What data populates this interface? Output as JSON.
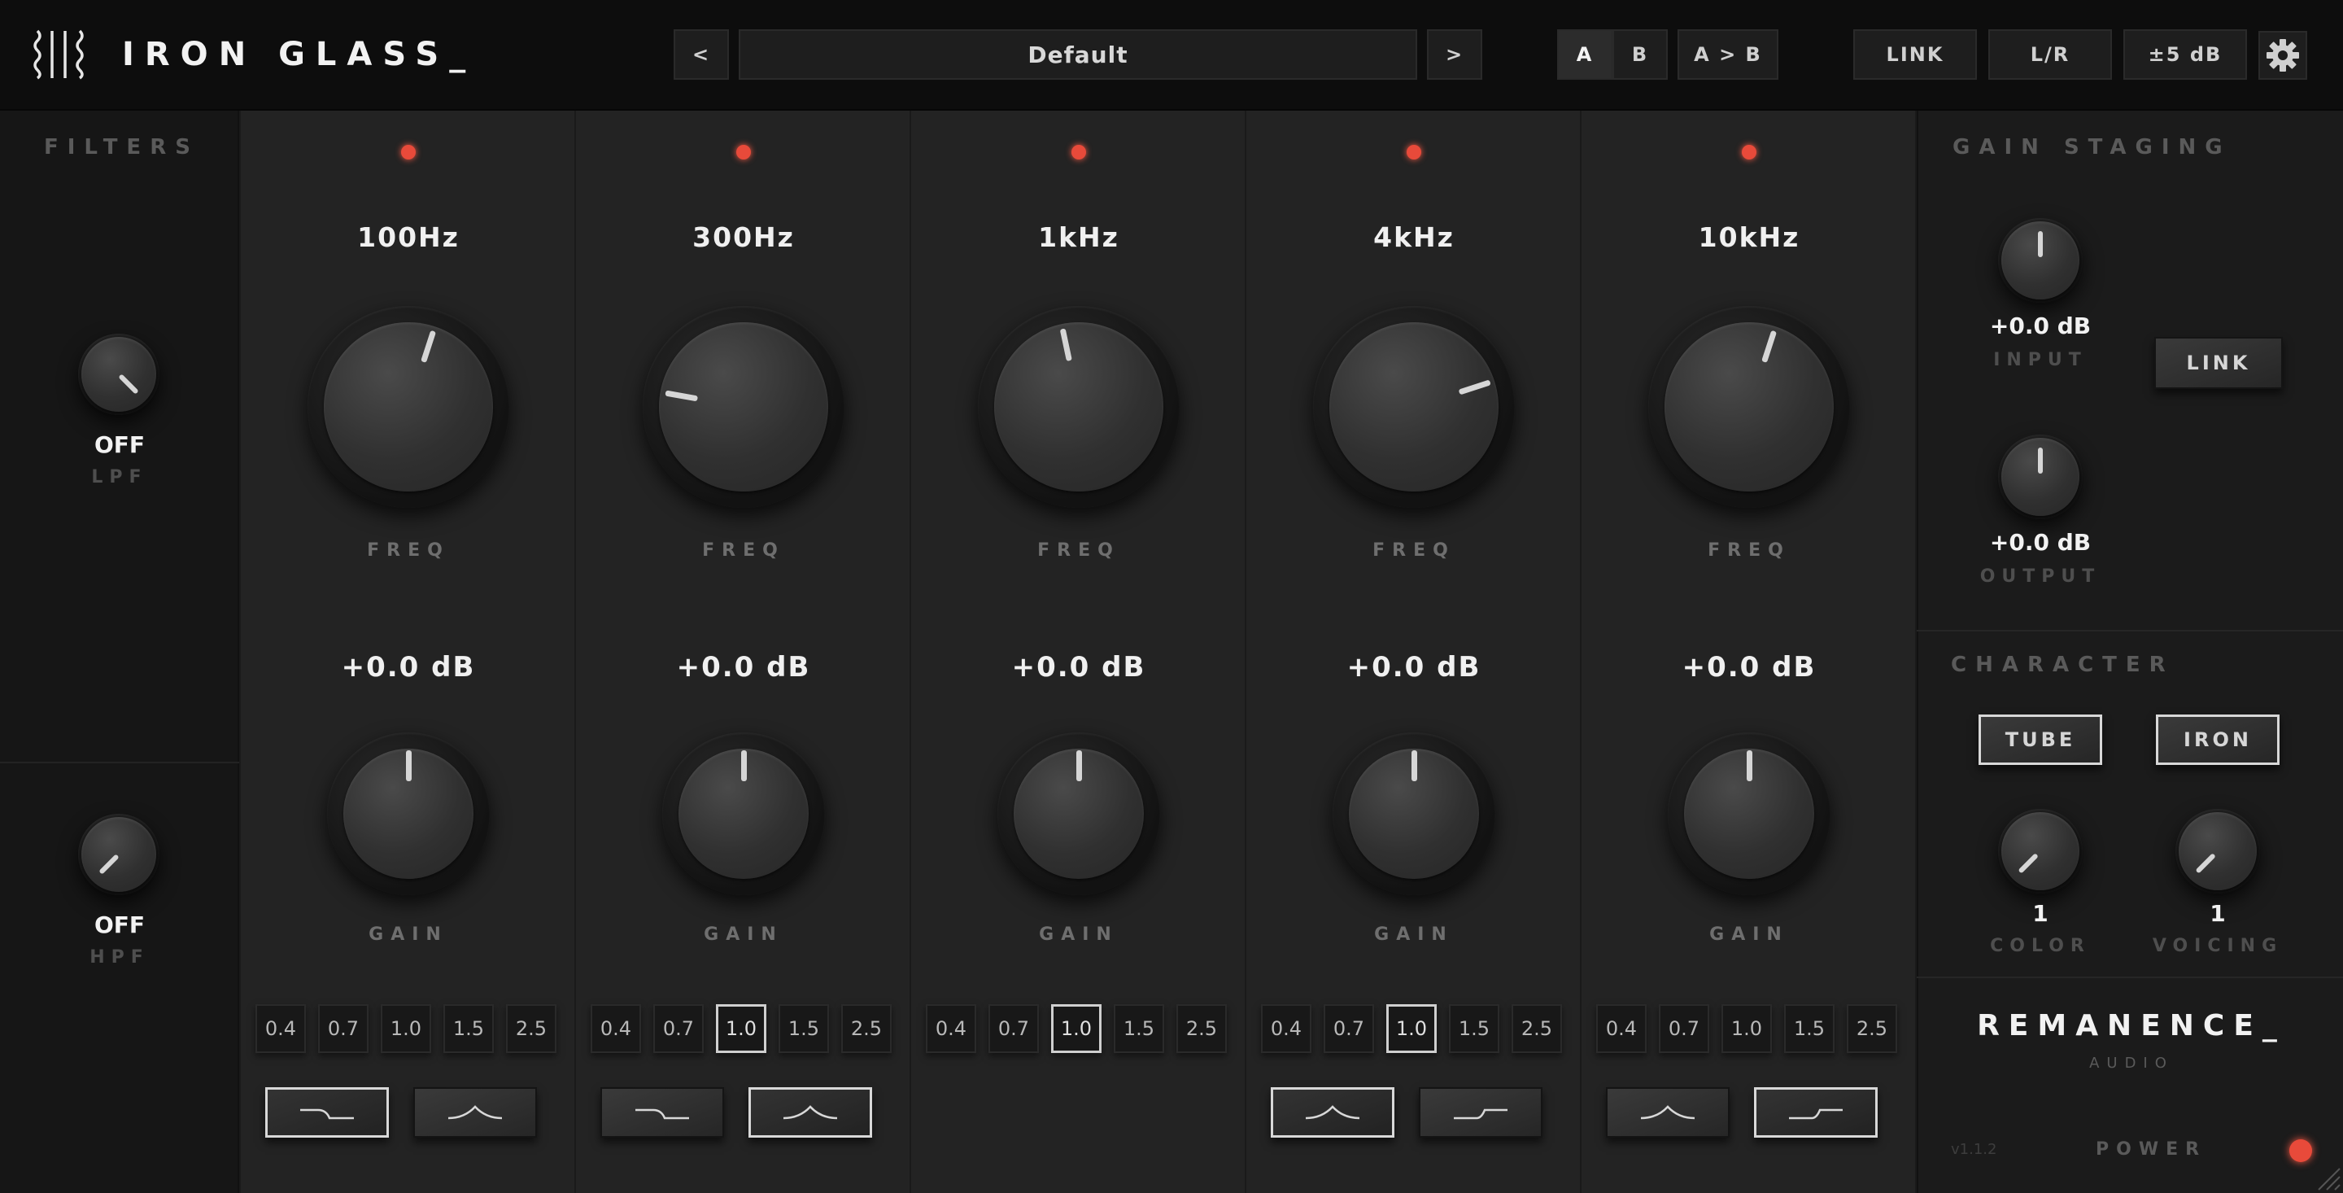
{
  "app": {
    "title": "IRON GLASS_"
  },
  "header": {
    "prev": "<",
    "next": ">",
    "preset": "Default",
    "ab": [
      "A",
      "B",
      "A > B"
    ],
    "ab_active": "A",
    "link": "LINK",
    "lr": "L/R",
    "range": "±5 dB"
  },
  "filters": {
    "title": "FILTERS",
    "lpf": {
      "value": "OFF",
      "label": "LPF"
    },
    "hpf": {
      "value": "OFF",
      "label": "HPF"
    }
  },
  "bands": [
    {
      "freq": "100Hz",
      "gain": "+0.0 dB",
      "freq_label": "FREQ",
      "gain_label": "GAIN",
      "q_options": [
        "0.4",
        "0.7",
        "1.0",
        "1.5",
        "2.5"
      ],
      "q_selected": null,
      "shapes": [
        "low-shelf",
        "bell"
      ],
      "shape_active": "low-shelf",
      "freq_angle": 18,
      "gain_angle": 0
    },
    {
      "freq": "300Hz",
      "gain": "+0.0 dB",
      "freq_label": "FREQ",
      "gain_label": "GAIN",
      "q_options": [
        "0.4",
        "0.7",
        "1.0",
        "1.5",
        "2.5"
      ],
      "q_selected": "1.0",
      "shapes": [
        "low-shelf",
        "bell"
      ],
      "shape_active": "bell",
      "freq_angle": -80,
      "gain_angle": 0
    },
    {
      "freq": "1kHz",
      "gain": "+0.0 dB",
      "freq_label": "FREQ",
      "gain_label": "GAIN",
      "q_options": [
        "0.4",
        "0.7",
        "1.0",
        "1.5",
        "2.5"
      ],
      "q_selected": "1.0",
      "shapes": [],
      "shape_active": null,
      "freq_angle": -12,
      "gain_angle": 0
    },
    {
      "freq": "4kHz",
      "gain": "+0.0 dB",
      "freq_label": "FREQ",
      "gain_label": "GAIN",
      "q_options": [
        "0.4",
        "0.7",
        "1.0",
        "1.5",
        "2.5"
      ],
      "q_selected": "1.0",
      "shapes": [
        "bell",
        "high-shelf"
      ],
      "shape_active": "bell",
      "freq_angle": 72,
      "gain_angle": 0
    },
    {
      "freq": "10kHz",
      "gain": "+0.0 dB",
      "freq_label": "FREQ",
      "gain_label": "GAIN",
      "q_options": [
        "0.4",
        "0.7",
        "1.0",
        "1.5",
        "2.5"
      ],
      "q_selected": null,
      "shapes": [
        "bell",
        "high-shelf"
      ],
      "shape_active": "high-shelf",
      "freq_angle": 18,
      "gain_angle": 0
    }
  ],
  "gain_staging": {
    "title": "GAIN STAGING",
    "input": {
      "value": "+0.0 dB",
      "label": "INPUT"
    },
    "output": {
      "value": "+0.0 dB",
      "label": "OUTPUT"
    },
    "link": "LINK"
  },
  "character": {
    "title": "CHARACTER",
    "tube": "TUBE",
    "iron": "IRON",
    "color": {
      "value": "1",
      "label": "COLOR"
    },
    "voicing": {
      "value": "1",
      "label": "VOICING"
    }
  },
  "brand": {
    "name": "REMANENCE_",
    "sub": "AUDIO",
    "version": "v1.1.2",
    "power": "POWER"
  },
  "colors": {
    "led": "#e84a3a",
    "background": "#1a1a1a",
    "panel": "#232323"
  }
}
